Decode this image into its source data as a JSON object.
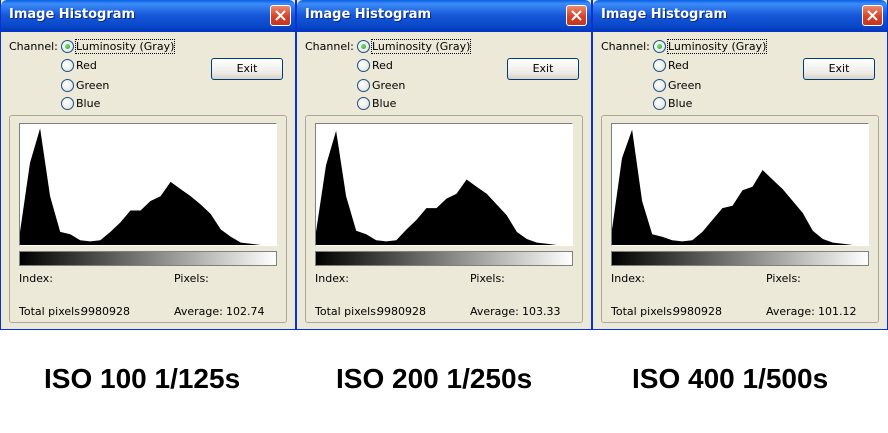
{
  "windows": [
    {
      "title": "Image Histogram",
      "channel_label": "Channel:",
      "channels": [
        "Luminosity (Gray)",
        "Red",
        "Green",
        "Blue"
      ],
      "selected_channel": "Luminosity (Gray)",
      "exit_label": "Exit",
      "index_label": "Index:",
      "pixels_label": "Pixels:",
      "total_pixels_label": "Total pixels:",
      "total_pixels": "9980928",
      "average_label": "Average:",
      "average": "102.74",
      "caption": "ISO 100 1/125s"
    },
    {
      "title": "Image Histogram",
      "channel_label": "Channel:",
      "channels": [
        "Luminosity (Gray)",
        "Red",
        "Green",
        "Blue"
      ],
      "selected_channel": "Luminosity (Gray)",
      "exit_label": "Exit",
      "index_label": "Index:",
      "pixels_label": "Pixels:",
      "total_pixels_label": "Total pixels:",
      "total_pixels": "9980928",
      "average_label": "Average:",
      "average": "103.33",
      "caption": "ISO 200 1/250s"
    },
    {
      "title": "Image Histogram",
      "channel_label": "Channel:",
      "channels": [
        "Luminosity (Gray)",
        "Red",
        "Green",
        "Blue"
      ],
      "selected_channel": "Luminosity (Gray)",
      "exit_label": "Exit",
      "index_label": "Index:",
      "pixels_label": "Pixels:",
      "total_pixels_label": "Total pixels:",
      "total_pixels": "9980928",
      "average_label": "Average:",
      "average": "101.12",
      "caption": "ISO 400 1/500s"
    }
  ],
  "colors": {
    "titlebar": "#0a5fe6",
    "window_bg": "#ece9d8",
    "histogram_fill": "#000000",
    "close_button": "#d7432a"
  },
  "icons": {
    "close": "close-icon",
    "radio": "radio-icon"
  },
  "chart_data": [
    {
      "type": "area",
      "x_range": [
        0,
        255
      ],
      "y_range": [
        0,
        1
      ],
      "x": [
        0,
        10,
        20,
        30,
        40,
        50,
        60,
        70,
        80,
        90,
        100,
        110,
        120,
        130,
        140,
        150,
        160,
        170,
        180,
        190,
        200,
        210,
        220,
        230,
        240,
        250,
        255
      ],
      "values": [
        0.12,
        0.68,
        0.99,
        0.4,
        0.12,
        0.08,
        0.04,
        0.03,
        0.04,
        0.1,
        0.2,
        0.28,
        0.3,
        0.36,
        0.42,
        0.52,
        0.48,
        0.4,
        0.35,
        0.25,
        0.14,
        0.06,
        0.02,
        0.01,
        0.0,
        0.0,
        0.0
      ]
    },
    {
      "type": "area",
      "x_range": [
        0,
        255
      ],
      "y_range": [
        0,
        1
      ],
      "x": [
        0,
        10,
        20,
        30,
        40,
        50,
        60,
        70,
        80,
        90,
        100,
        110,
        120,
        130,
        140,
        150,
        160,
        170,
        180,
        190,
        200,
        210,
        220,
        230,
        240,
        250,
        255
      ],
      "values": [
        0.12,
        0.66,
        0.97,
        0.4,
        0.13,
        0.08,
        0.04,
        0.03,
        0.04,
        0.12,
        0.22,
        0.3,
        0.32,
        0.38,
        0.44,
        0.54,
        0.5,
        0.42,
        0.35,
        0.24,
        0.12,
        0.05,
        0.02,
        0.01,
        0.0,
        0.0,
        0.0
      ]
    },
    {
      "type": "area",
      "x_range": [
        0,
        255
      ],
      "y_range": [
        0,
        1
      ],
      "x": [
        0,
        10,
        20,
        30,
        40,
        50,
        60,
        70,
        80,
        90,
        100,
        110,
        120,
        130,
        140,
        150,
        160,
        170,
        180,
        190,
        200,
        210,
        220,
        230,
        240,
        250,
        255
      ],
      "values": [
        0.14,
        0.72,
        0.98,
        0.36,
        0.1,
        0.06,
        0.04,
        0.03,
        0.04,
        0.1,
        0.22,
        0.3,
        0.34,
        0.45,
        0.5,
        0.62,
        0.56,
        0.46,
        0.38,
        0.26,
        0.13,
        0.05,
        0.02,
        0.01,
        0.0,
        0.0,
        0.0
      ]
    }
  ]
}
